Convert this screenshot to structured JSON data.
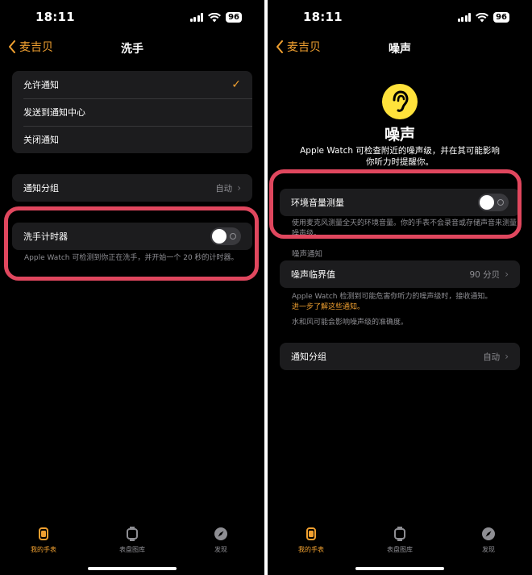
{
  "status": {
    "time": "18:11",
    "battery": "96"
  },
  "left": {
    "nav": {
      "back_label": "麦吉贝",
      "title": "洗手"
    },
    "notify_options": [
      {
        "label": "允许通知",
        "checked": true
      },
      {
        "label": "发送到通知中心",
        "checked": false
      },
      {
        "label": "关闭通知",
        "checked": false
      }
    ],
    "grouping": {
      "label": "通知分组",
      "value": "自动"
    },
    "timer": {
      "label": "洗手计时器",
      "on": false,
      "note": "Apple Watch 可检测到你正在洗手，并开始一个 20 秒的计时器。"
    }
  },
  "right": {
    "nav": {
      "back_label": "麦吉贝",
      "title": "噪声"
    },
    "hero": {
      "title": "噪声",
      "description": "Apple Watch 可检查附近的噪声级，并在其可能影响你听力时提醒你。"
    },
    "measure": {
      "label": "环境音量测量",
      "on": false,
      "note": "使用麦克风测量全天的环境音量。你的手表不会录音或存储声音来测量噪声级。"
    },
    "section_header": "噪声通知",
    "threshold": {
      "label": "噪声临界值",
      "value": "90 分贝"
    },
    "threshold_note": "Apple Watch 检测到可能危害你听力的噪声级时，接收通知。",
    "learn_more": "进一步了解这些通知。",
    "water_note": "水和风可能会影响噪声级的准确度。",
    "grouping": {
      "label": "通知分组",
      "value": "自动"
    }
  },
  "tabs": [
    {
      "label": "我的手表",
      "icon": "watch-icon",
      "active": true
    },
    {
      "label": "表盘图库",
      "icon": "watch-face-icon",
      "active": false
    },
    {
      "label": "发现",
      "icon": "compass-icon",
      "active": false
    }
  ],
  "colors": {
    "accent": "#f0a030",
    "highlight": "#e0475e",
    "ear": "#ffe23b",
    "cell": "#1c1c1e"
  }
}
